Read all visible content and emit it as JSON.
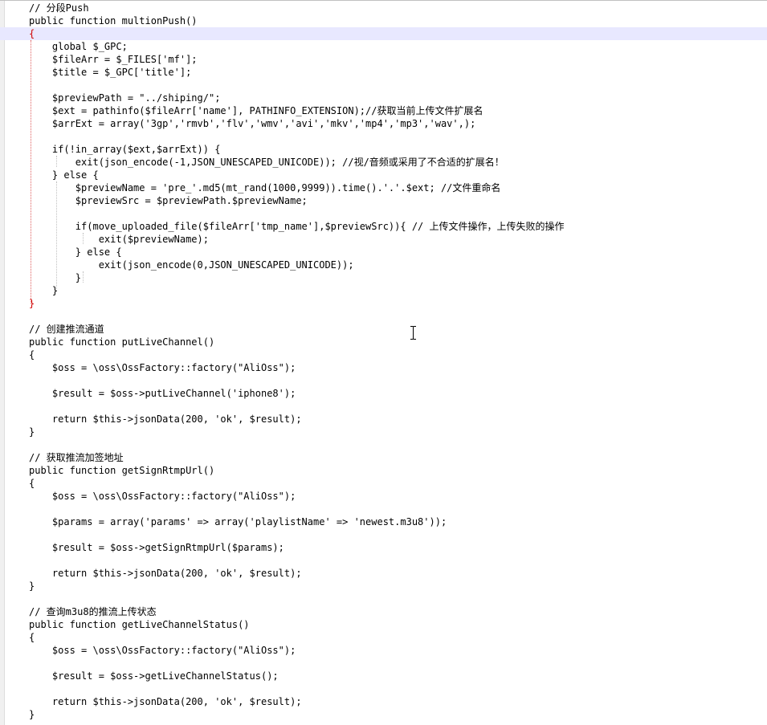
{
  "editor": {
    "current_line_color": "#e8e8ff",
    "brace_highlight_color": "#d00000"
  },
  "lines": [
    "// 分段Push",
    "public function multionPush()",
    "{",
    "    global $_GPC;",
    "    $fileArr = $_FILES['mf'];",
    "    $title = $_GPC['title'];",
    "",
    "    $previewPath = \"../shiping/\";",
    "    $ext = pathinfo($fileArr['name'], PATHINFO_EXTENSION);//获取当前上传文件扩展名",
    "    $arrExt = array('3gp','rmvb','flv','wmv','avi','mkv','mp4','mp3','wav',);",
    "",
    "    if(!in_array($ext,$arrExt)) {",
    "        exit(json_encode(-1,JSON_UNESCAPED_UNICODE)); //视/音频或采用了不合适的扩展名！",
    "    } else {",
    "        $previewName = 'pre_'.md5(mt_rand(1000,9999)).time().'.'.$ext; //文件重命名",
    "        $previewSrc = $previewPath.$previewName;",
    "",
    "        if(move_uploaded_file($fileArr['tmp_name'],$previewSrc)){ // 上传文件操作，上传失败的操作",
    "            exit($previewName);",
    "        } else {",
    "            exit(json_encode(0,JSON_UNESCAPED_UNICODE));",
    "        }",
    "    }",
    "}",
    "",
    "// 创建推流通道",
    "public function putLiveChannel()",
    "{",
    "    $oss = \\oss\\OssFactory::factory(\"AliOss\");",
    "",
    "    $result = $oss->putLiveChannel('iphone8');",
    "",
    "    return $this->jsonData(200, 'ok', $result);",
    "}",
    "",
    "// 获取推流加签地址",
    "public function getSignRtmpUrl()",
    "{",
    "    $oss = \\oss\\OssFactory::factory(\"AliOss\");",
    "",
    "    $params = array('params' => array('playlistName' => 'newest.m3u8'));",
    "",
    "    $result = $oss->getSignRtmpUrl($params);",
    "",
    "    return $this->jsonData(200, 'ok', $result);",
    "}",
    "",
    "// 查询m3u8的推流上传状态",
    "public function getLiveChannelStatus()",
    "{",
    "    $oss = \\oss\\OssFactory::factory(\"AliOss\");",
    "",
    "    $result = $oss->getLiveChannelStatus();",
    "",
    "    return $this->jsonData(200, 'ok', $result);",
    "}"
  ]
}
